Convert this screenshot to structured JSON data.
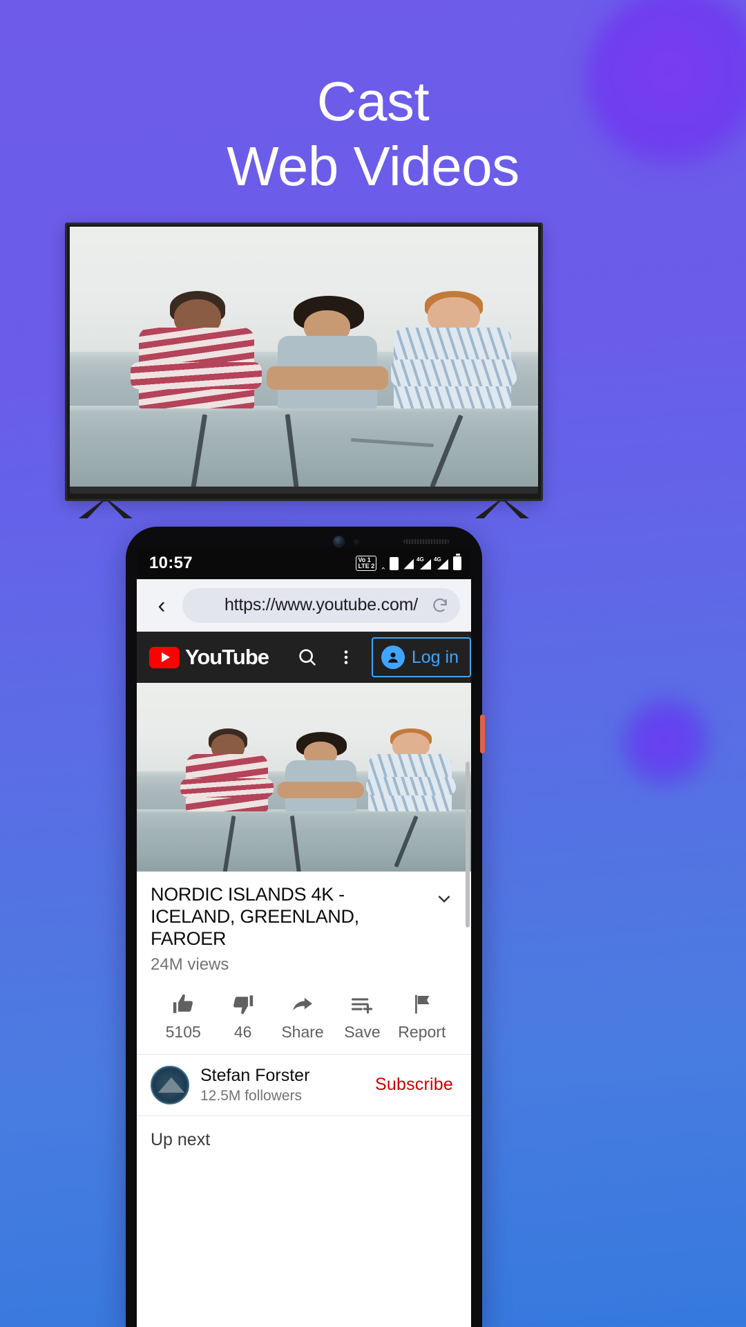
{
  "theme": {
    "bg_top": "#6E5BEA",
    "bg_bottom": "#3579DE",
    "accent_blue": "#3ea6ff",
    "youtube_red": "#ff0000",
    "subscribe_red": "#cc0000"
  },
  "headline": {
    "line1": "Cast",
    "line2": "Web Videos"
  },
  "statusbar": {
    "time": "10:57",
    "volte_line1": "Vo 1",
    "volte_line2": "LTE 2",
    "signal1_label": "4G",
    "signal2_label": "4G"
  },
  "browser": {
    "url": "https://www.youtube.com/",
    "back_label": "‹"
  },
  "yt_header": {
    "brand": "YouTube",
    "login_label": "Log in"
  },
  "video": {
    "title": "NORDIC ISLANDS 4K - ICELAND, GREENLAND, FAROER",
    "views": "24M views",
    "actions": [
      {
        "label": "5105",
        "icon": "thumb-up-icon"
      },
      {
        "label": "46",
        "icon": "thumb-down-icon"
      },
      {
        "label": "Share",
        "icon": "share-icon"
      },
      {
        "label": "Save",
        "icon": "save-playlist-icon"
      },
      {
        "label": "Report",
        "icon": "flag-icon"
      }
    ]
  },
  "channel": {
    "name": "Stefan Forster",
    "followers": "12.5M followers",
    "subscribe_label": "Subscribe"
  },
  "upnext": {
    "label": "Up next"
  }
}
